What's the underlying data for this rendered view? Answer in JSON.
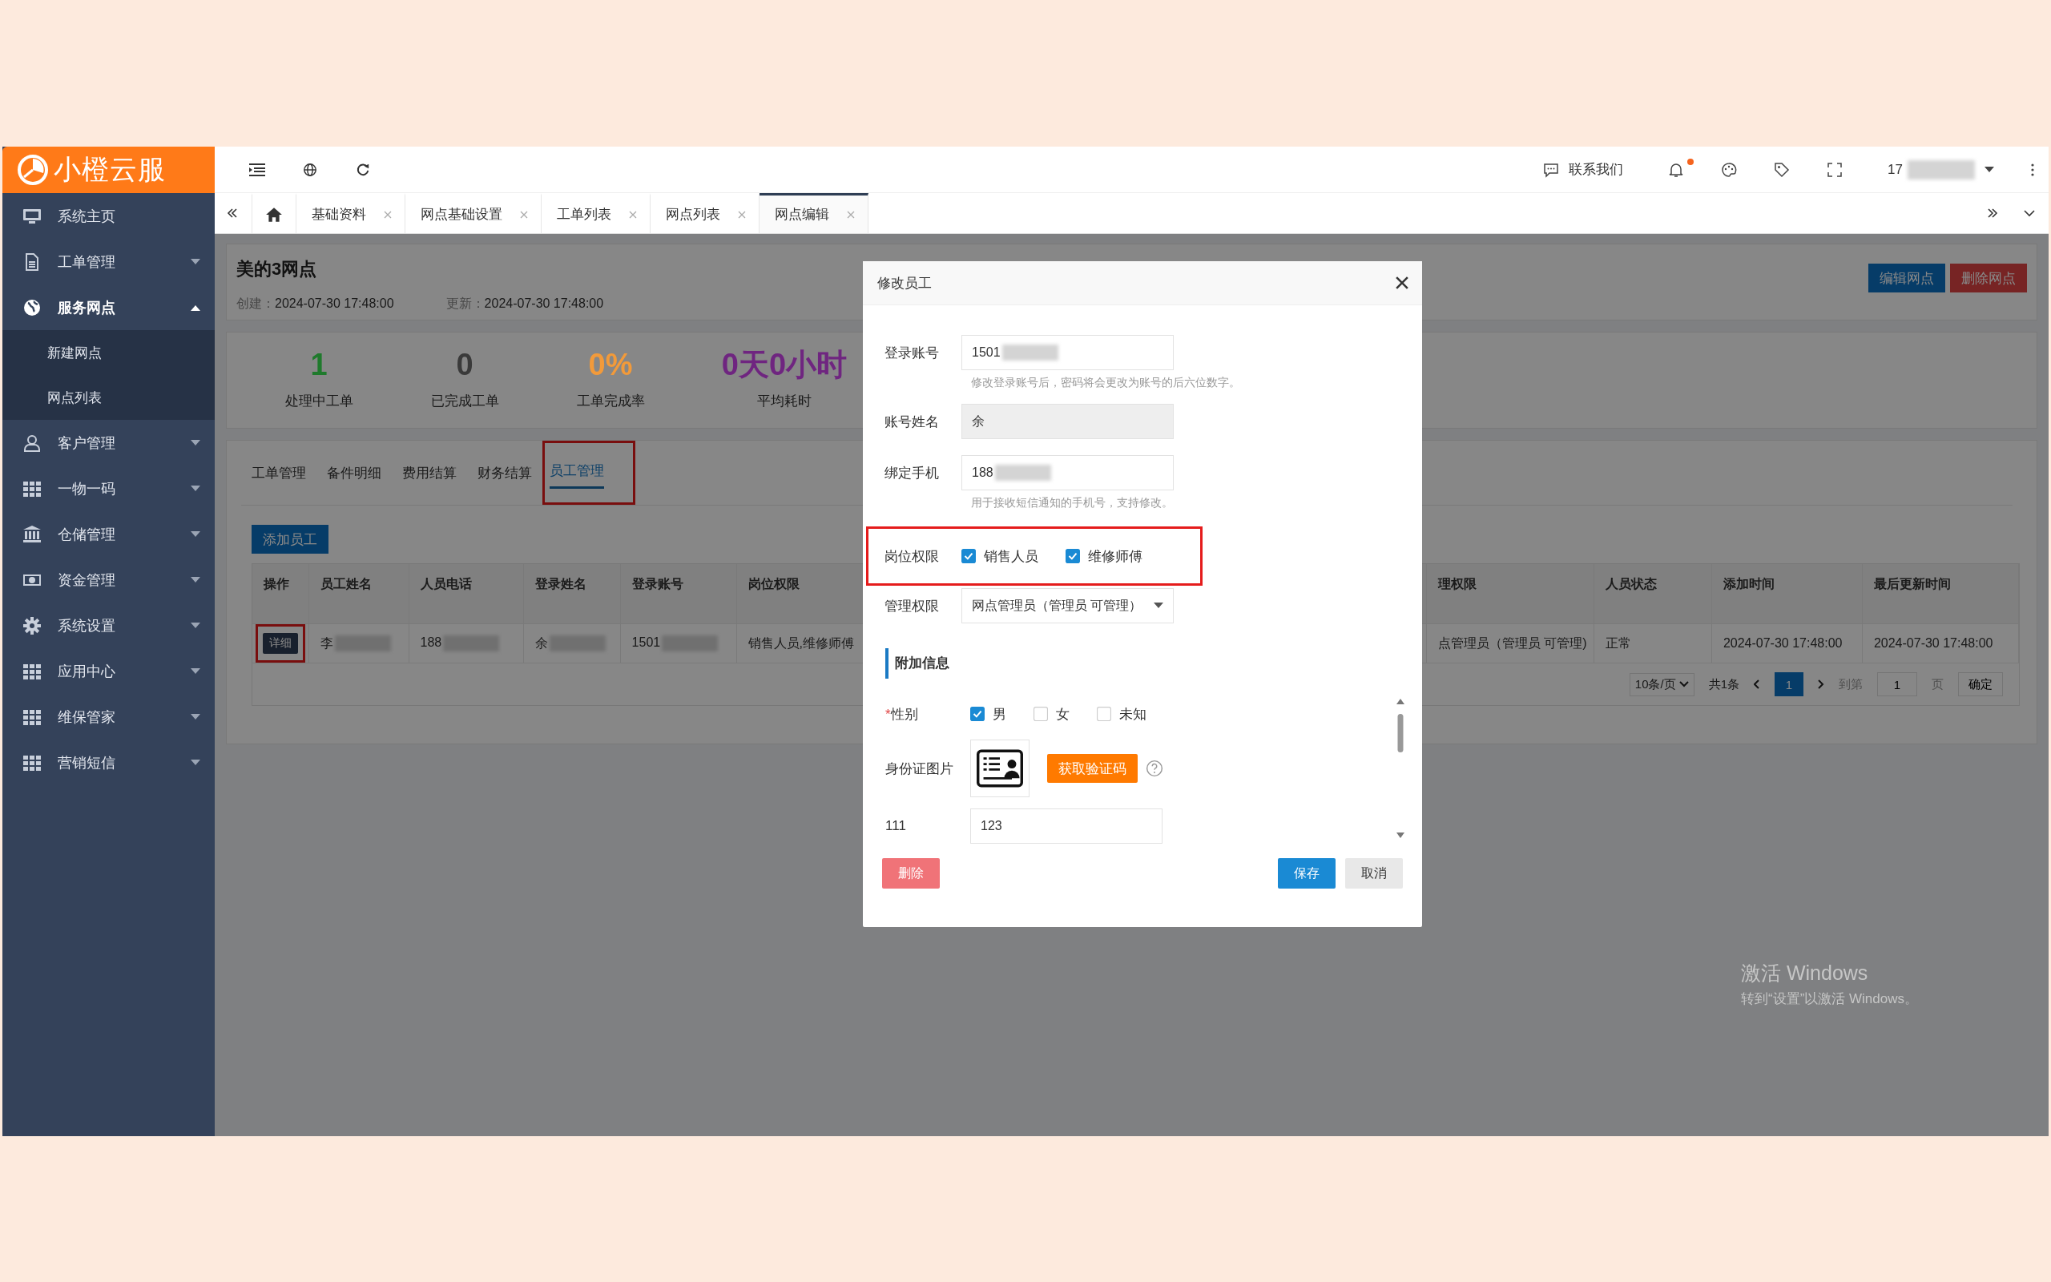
{
  "brand": {
    "name": "小橙云服"
  },
  "sidebar": {
    "items": [
      {
        "label": "系统主页",
        "expandable": false,
        "expanded": false
      },
      {
        "label": "工单管理",
        "expandable": true,
        "expanded": false
      },
      {
        "label": "服务网点",
        "expandable": true,
        "expanded": true,
        "children": [
          {
            "label": "新建网点"
          },
          {
            "label": "网点列表"
          }
        ]
      },
      {
        "label": "客户管理",
        "expandable": true,
        "expanded": false
      },
      {
        "label": "一物一码",
        "expandable": true,
        "expanded": false
      },
      {
        "label": "仓储管理",
        "expandable": true,
        "expanded": false
      },
      {
        "label": "资金管理",
        "expandable": true,
        "expanded": false
      },
      {
        "label": "系统设置",
        "expandable": true,
        "expanded": false
      },
      {
        "label": "应用中心",
        "expandable": true,
        "expanded": false
      },
      {
        "label": "维保管家",
        "expandable": true,
        "expanded": false
      },
      {
        "label": "营销短信",
        "expandable": true,
        "expanded": false
      }
    ]
  },
  "topbar": {
    "contact": "联系我们",
    "notification_dot": true,
    "user": "17",
    "user_redacted": true
  },
  "tabs": [
    {
      "label": "基础资料",
      "selected": false
    },
    {
      "label": "网点基础设置",
      "selected": false
    },
    {
      "label": "工单列表",
      "selected": false
    },
    {
      "label": "网点列表",
      "selected": false
    },
    {
      "label": "网点编辑",
      "selected": true
    }
  ],
  "site": {
    "title": "美的3网点",
    "created_label": "创建：",
    "created": "2024-07-30 17:48:00",
    "updated_label": "更新：",
    "updated": "2024-07-30 17:48:00",
    "buttons": [
      {
        "label": "编辑网点",
        "kind": "primary"
      },
      {
        "label": "删除网点",
        "kind": "danger"
      }
    ]
  },
  "stats": [
    {
      "value": "1",
      "label": "处理中工单",
      "color": "#1f7a2c"
    },
    {
      "value": "0",
      "label": "已完成工单",
      "color": "#3a3a3a"
    },
    {
      "value": "0%",
      "label": "工单完成率",
      "color": "#f29a3a"
    },
    {
      "value": "0天0小时",
      "label": "平均耗时",
      "color": "#6f2580"
    }
  ],
  "sub_tabs": [
    {
      "label": "工单管理",
      "selected": false,
      "highlighted": false
    },
    {
      "label": "备件明细",
      "selected": false,
      "highlighted": false
    },
    {
      "label": "费用结算",
      "selected": false,
      "highlighted": false
    },
    {
      "label": "财务结算",
      "selected": false,
      "highlighted": false
    },
    {
      "label": "员工管理",
      "selected": true,
      "highlighted": true
    }
  ],
  "add_button": "添加员工",
  "table": {
    "columns_left": [
      "操作",
      "员工姓名",
      "人员电话",
      "登录姓名",
      "登录账号",
      "岗位权限"
    ],
    "columns_right": [
      "理权限",
      "人员状态",
      "添加时间",
      "最后更新时间"
    ],
    "rows": [
      {
        "action": {
          "label": "详细",
          "highlighted": true
        },
        "left": [
          {
            "text": "李",
            "redacted": true
          },
          {
            "text": "188",
            "redacted": true
          },
          {
            "text": "余",
            "redacted": true
          },
          {
            "text": "1501",
            "redacted": true
          },
          {
            "text": "销售人员,维修师傅",
            "redacted": false
          }
        ],
        "right": [
          {
            "text": "点管理员（管理员 可管理)",
            "redacted": false
          },
          {
            "text": "正常",
            "redacted": false
          },
          {
            "text": "2024-07-30 17:48:00",
            "redacted": false
          },
          {
            "text": "2024-07-30 17:48:00",
            "redacted": false
          }
        ]
      }
    ]
  },
  "pagination": {
    "page_size": "10条/页",
    "total": "共1条",
    "pages": [
      {
        "label": "1",
        "selected": true
      }
    ],
    "goto_label": "到第",
    "goto_value": "1",
    "page_unit": "页",
    "confirm": "确定"
  },
  "modal": {
    "title": "修改员工",
    "fields": [
      {
        "kind": "text",
        "label": "登录账号",
        "value": "1501",
        "redacted": true,
        "disabled": false,
        "highlighted": false,
        "help": "修改登录账号后，密码将会更改为账号的后六位数字。"
      },
      {
        "kind": "text",
        "label": "账号姓名",
        "value": "余",
        "redacted": false,
        "disabled": true,
        "highlighted": false
      },
      {
        "kind": "text",
        "label": "绑定手机",
        "value": "188",
        "redacted": true,
        "disabled": false,
        "highlighted": false,
        "help": "用于接收短信通知的手机号，支持修改。"
      },
      {
        "kind": "checkboxes",
        "label": "岗位权限",
        "redacted": false,
        "disabled": false,
        "highlighted": true,
        "options": [
          {
            "label": "销售人员",
            "checked": true
          },
          {
            "label": "维修师傅",
            "checked": true
          }
        ]
      },
      {
        "kind": "select",
        "label": "管理权限",
        "value": "网点管理员（管理员 可管理）",
        "redacted": false,
        "disabled": false,
        "highlighted": false
      }
    ],
    "section": "附加信息",
    "extra_fields": [
      {
        "kind": "checkboxes",
        "label": "性别",
        "required_mark": "*",
        "options": [
          {
            "label": "男",
            "checked": true
          },
          {
            "label": "女",
            "checked": false
          },
          {
            "label": "未知",
            "checked": false
          }
        ]
      },
      {
        "kind": "image",
        "label": "身份证图片",
        "button": "获取验证码"
      },
      {
        "kind": "text",
        "label": "111",
        "value": "123"
      }
    ],
    "buttons": [
      {
        "label": "删除",
        "kind": "danger"
      },
      {
        "label": "保存",
        "kind": "primary"
      },
      {
        "label": "取消",
        "kind": "default"
      }
    ]
  },
  "os_notice": {
    "title": "激活 Windows",
    "text": "转到“设置”以激活 Windows。"
  }
}
